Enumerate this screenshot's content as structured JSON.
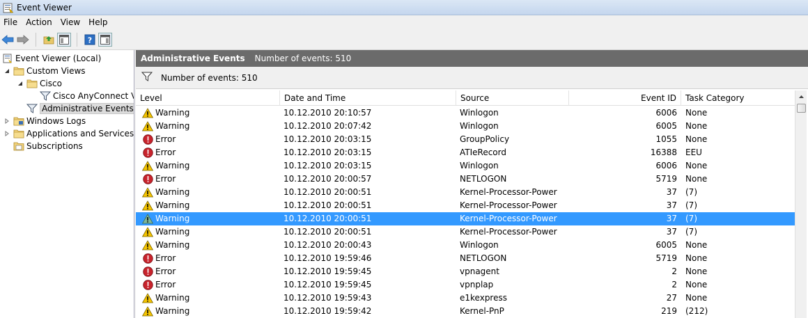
{
  "window": {
    "title": "Event Viewer"
  },
  "menu": [
    "File",
    "Action",
    "View",
    "Help"
  ],
  "tree": {
    "items": [
      {
        "label": "Event Viewer (Local)",
        "icon": "event-viewer-icon"
      },
      {
        "label": "Custom Views",
        "icon": "folder-icon"
      },
      {
        "label": "Cisco",
        "icon": "folder-icon"
      },
      {
        "label": "Cisco AnyConnect VPN",
        "icon": "filter-icon"
      },
      {
        "label": "Administrative Events",
        "icon": "filter-icon"
      },
      {
        "label": "Windows Logs",
        "icon": "folder-icon"
      },
      {
        "label": "Applications and Services Logs",
        "icon": "folder-icon"
      },
      {
        "label": "Subscriptions",
        "icon": "subscriptions-icon"
      }
    ]
  },
  "pane": {
    "title": "Administrative Events",
    "count_text": "Number of events: 510",
    "filter_text": "Number of events: 510"
  },
  "table": {
    "columns": [
      "Level",
      "Date and Time",
      "Source",
      "Event ID",
      "Task Category"
    ],
    "rows": [
      {
        "level": "Warning",
        "date": "10.12.2010 20:10:57",
        "source": "Winlogon",
        "event_id": "6006",
        "task": "None"
      },
      {
        "level": "Warning",
        "date": "10.12.2010 20:07:42",
        "source": "Winlogon",
        "event_id": "6005",
        "task": "None"
      },
      {
        "level": "Error",
        "date": "10.12.2010 20:03:15",
        "source": "GroupPolicy",
        "event_id": "1055",
        "task": "None"
      },
      {
        "level": "Error",
        "date": "10.12.2010 20:03:15",
        "source": "ATIeRecord",
        "event_id": "16388",
        "task": "EEU"
      },
      {
        "level": "Warning",
        "date": "10.12.2010 20:03:15",
        "source": "Winlogon",
        "event_id": "6006",
        "task": "None"
      },
      {
        "level": "Error",
        "date": "10.12.2010 20:00:57",
        "source": "NETLOGON",
        "event_id": "5719",
        "task": "None"
      },
      {
        "level": "Warning",
        "date": "10.12.2010 20:00:51",
        "source": "Kernel-Processor-Power",
        "event_id": "37",
        "task": "(7)"
      },
      {
        "level": "Warning",
        "date": "10.12.2010 20:00:51",
        "source": "Kernel-Processor-Power",
        "event_id": "37",
        "task": "(7)"
      },
      {
        "level": "Warning",
        "date": "10.12.2010 20:00:51",
        "source": "Kernel-Processor-Power",
        "event_id": "37",
        "task": "(7)"
      },
      {
        "level": "Warning",
        "date": "10.12.2010 20:00:51",
        "source": "Kernel-Processor-Power",
        "event_id": "37",
        "task": "(7)"
      },
      {
        "level": "Warning",
        "date": "10.12.2010 20:00:43",
        "source": "Winlogon",
        "event_id": "6005",
        "task": "None"
      },
      {
        "level": "Error",
        "date": "10.12.2010 19:59:46",
        "source": "NETLOGON",
        "event_id": "5719",
        "task": "None"
      },
      {
        "level": "Error",
        "date": "10.12.2010 19:59:45",
        "source": "vpnagent",
        "event_id": "2",
        "task": "None"
      },
      {
        "level": "Error",
        "date": "10.12.2010 19:59:45",
        "source": "vpnplap",
        "event_id": "2",
        "task": "None"
      },
      {
        "level": "Warning",
        "date": "10.12.2010 19:59:43",
        "source": "e1kexpress",
        "event_id": "27",
        "task": "None"
      },
      {
        "level": "Warning",
        "date": "10.12.2010 19:59:42",
        "source": "Kernel-PnP",
        "event_id": "219",
        "task": "(212)"
      }
    ],
    "selected_row": 8
  },
  "colors": {
    "selection": "#3399ff",
    "header_bar": "#6b6b6b",
    "warning": "#f5c400",
    "error": "#c8232c"
  }
}
